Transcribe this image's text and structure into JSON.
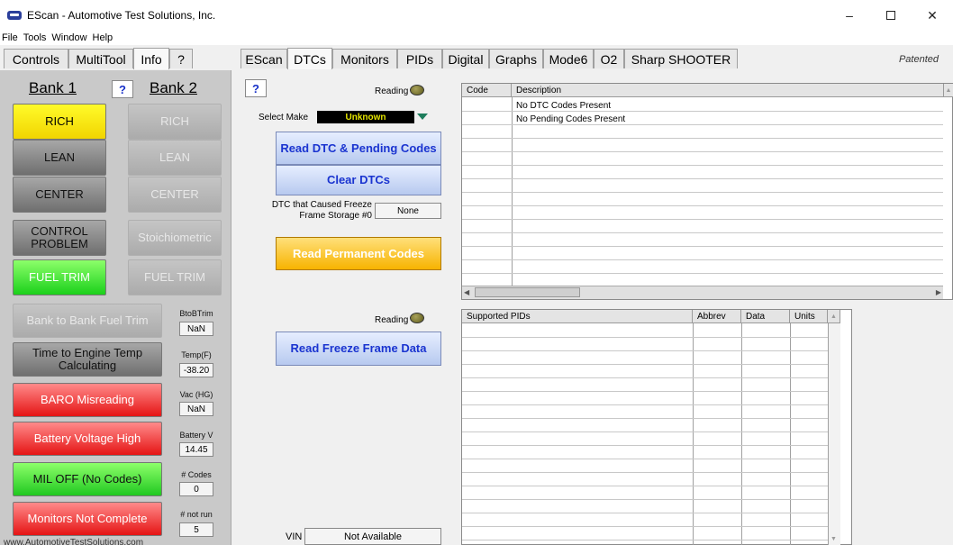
{
  "window": {
    "title": "EScan - Automotive Test Solutions, Inc.",
    "minimize": "–",
    "close": "✕"
  },
  "menu": [
    "File",
    "Tools",
    "Window",
    "Help"
  ],
  "left_tabs": [
    "Controls",
    "MultiTool",
    "Info",
    "?"
  ],
  "main_tabs": [
    "EScan",
    "DTCs",
    "Monitors",
    "PIDs",
    "Digital",
    "Graphs",
    "Mode6",
    "O2",
    "Sharp SHOOTER"
  ],
  "patented": "Patented",
  "bank": {
    "bank1": "Bank 1",
    "bank2": "Bank 2",
    "help": "?"
  },
  "indicators": {
    "rich1": "RICH",
    "rich2": "RICH",
    "lean1": "LEAN",
    "lean2": "LEAN",
    "center1": "CENTER",
    "center2": "CENTER",
    "control": "CONTROL PROBLEM",
    "stoich": "Stoichiometric",
    "fuel1": "FUEL TRIM",
    "fuel2": "FUEL TRIM",
    "btob": "Bank to Bank Fuel Trim",
    "time_to_engine": "Time to Engine Temp Calculating",
    "baro": "BARO Misreading",
    "battery": "Battery Voltage High",
    "mil": "MIL OFF (No Codes)",
    "monitors": "Monitors Not Complete"
  },
  "side": {
    "btob_label": "BtoBTrim",
    "btob_value": "NaN",
    "temp_label": "Temp(F)",
    "temp_value": "-38.20",
    "vac_label": "Vac (HG)",
    "vac_value": "NaN",
    "batt_label": "Battery V",
    "batt_value": "14.45",
    "codes_label": "# Codes",
    "codes_value": "0",
    "notrun_label": "# not run",
    "notrun_value": "5"
  },
  "website": "www.AutomotiveTestSolutions.com",
  "middle": {
    "help": "?",
    "reading1": "Reading",
    "select_make_label": "Select Make",
    "select_make_value": "Unknown",
    "read_dtc": "Read DTC & Pending Codes",
    "clear_dtc": "Clear DTCs",
    "freeze_label": "DTC that Caused Freeze Frame Storage #0",
    "freeze_value": "None",
    "read_permanent": "Read Permanent Codes",
    "reading2": "Reading",
    "read_freeze": "Read Freeze Frame Data",
    "vin_label": "VIN",
    "vin_value": "Not Available"
  },
  "dtc_table": {
    "headers": [
      "Code",
      "Description"
    ],
    "rows": [
      [
        "",
        "No DTC Codes Present"
      ],
      [
        "",
        "No Pending Codes Present"
      ]
    ]
  },
  "pid_table": {
    "headers": [
      "Supported PIDs",
      "Abbrev",
      "Data",
      "Units"
    ]
  },
  "colors": {
    "blue_text": "#1a34d0",
    "yellow_btn": "#f7b300",
    "red": "#e51414",
    "green": "#1bd01b"
  }
}
